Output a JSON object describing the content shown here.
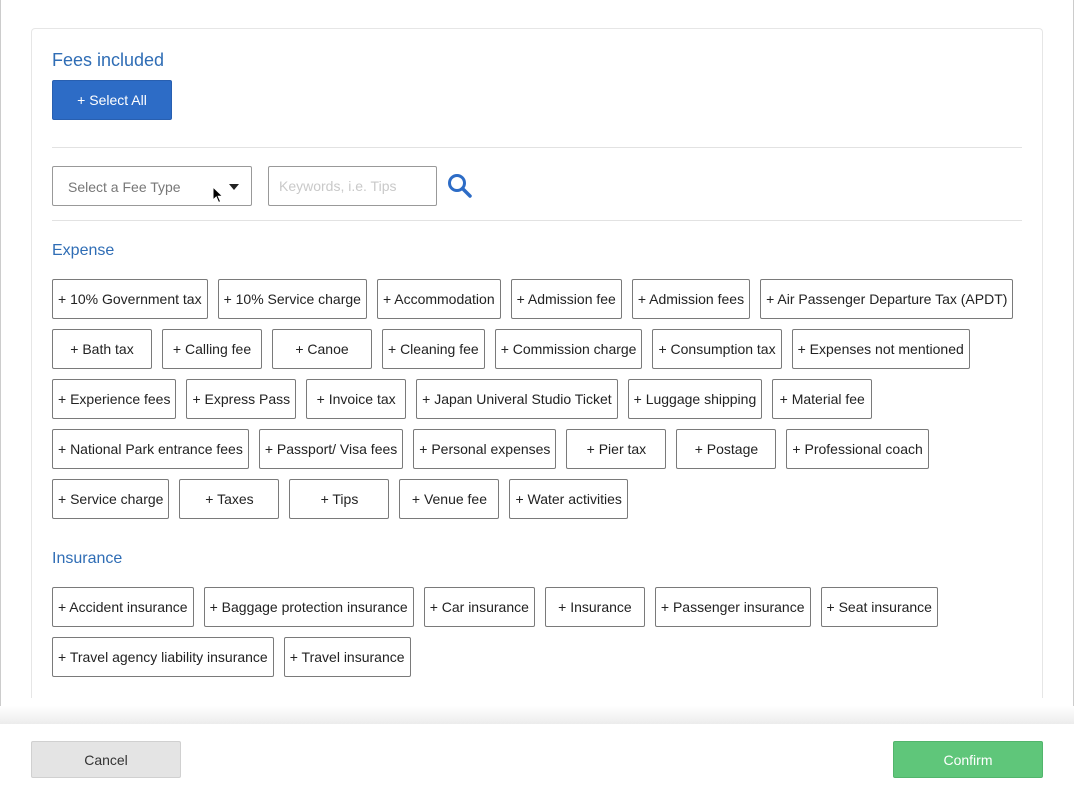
{
  "fees_panel": {
    "title": "Fees included",
    "select_all_label": "+ Select All",
    "fee_type_placeholder": "Select a Fee Type",
    "keyword_placeholder": "Keywords, i.e. Tips",
    "icons": {
      "search": "search-icon",
      "dropdown": "caret-down-icon",
      "cursor": "mouse-pointer-icon"
    }
  },
  "sections": [
    {
      "title": "Expense",
      "items": [
        "+ 10% Government tax",
        "+ 10% Service charge",
        "+ Accommodation",
        "+ Admission fee",
        "+ Admission fees",
        "+ Air Passenger Departure Tax (APDT)",
        "+ Bath tax",
        "+ Calling fee",
        "+ Canoe",
        "+ Cleaning fee",
        "+ Commission charge",
        "+ Consumption tax",
        "+ Expenses not mentioned",
        "+ Experience fees",
        "+ Express Pass",
        "+ Invoice tax",
        "+ Japan Univeral Studio Ticket",
        "+ Luggage shipping",
        "+ Material fee",
        "+ National Park entrance fees",
        "+ Passport/ Visa fees",
        "+ Personal expenses",
        "+ Pier tax",
        "+ Postage",
        "+ Professional coach",
        "+ Service charge",
        "+ Taxes",
        "+ Tips",
        "+ Venue fee",
        "+ Water activities"
      ]
    },
    {
      "title": "Insurance",
      "items": [
        "+ Accident insurance",
        "+ Baggage protection insurance",
        "+ Car insurance",
        "+ Insurance",
        "+ Passenger insurance",
        "+ Seat insurance",
        "+ Travel agency liability insurance",
        "+ Travel insurance"
      ]
    }
  ],
  "footer": {
    "cancel_label": "Cancel",
    "confirm_label": "Confirm"
  },
  "colors": {
    "accent": "#2d6cc6",
    "heading": "#2f6db5",
    "confirm": "#5fc67a",
    "cancel": "#e4e4e4"
  }
}
